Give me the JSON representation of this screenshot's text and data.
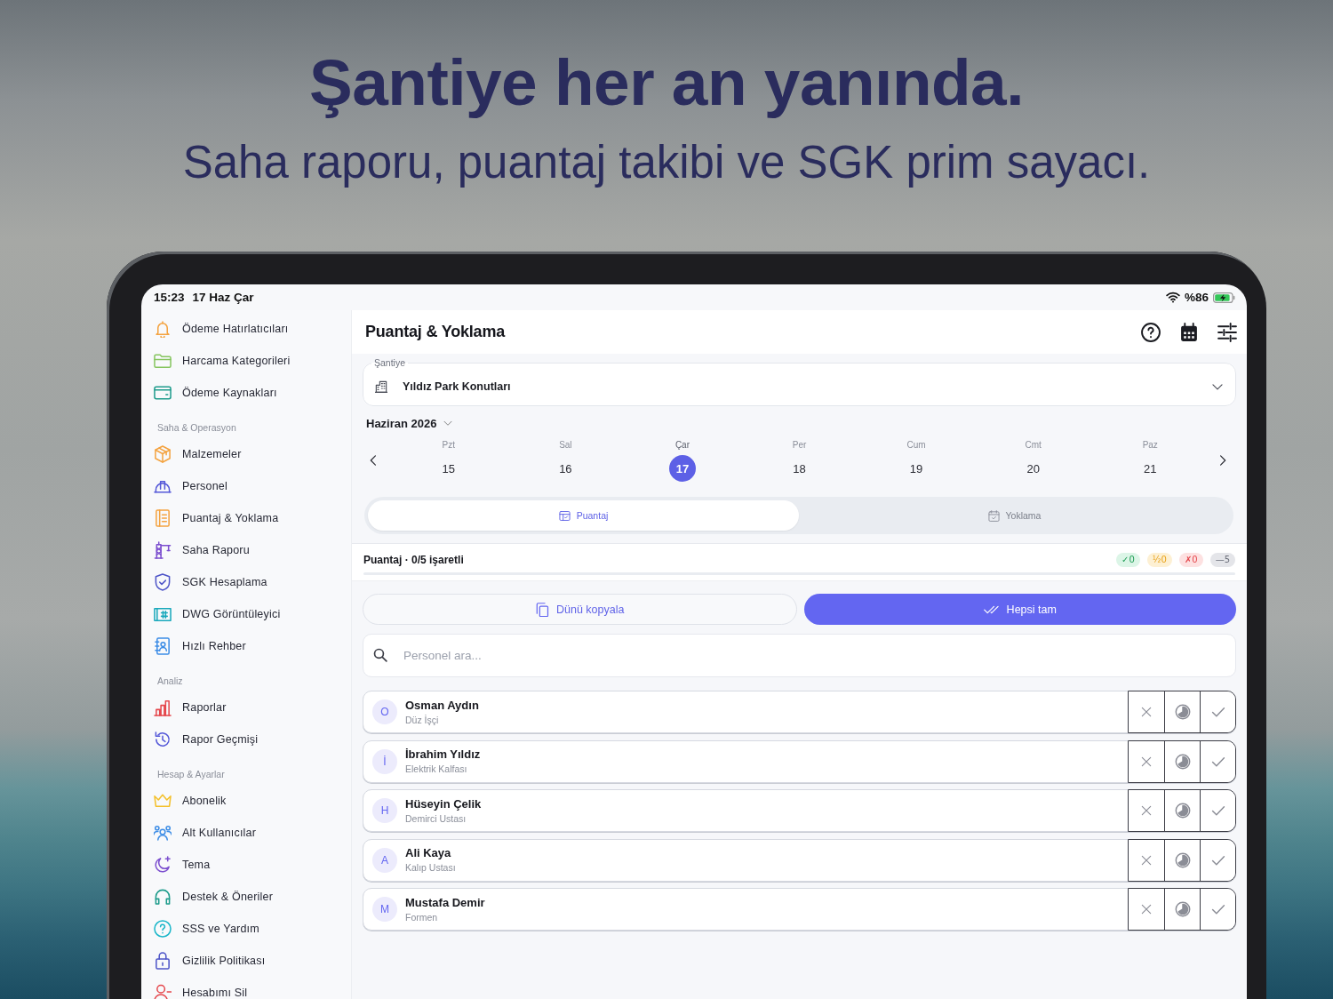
{
  "headline": {
    "title": "Şantiye her an yanında.",
    "subtitle": "Saha raporu, puantaj takibi ve SGK prim sayacı."
  },
  "status_bar": {
    "time": "15:23",
    "date": "17 Haz Çar",
    "battery": "%86",
    "charging": true
  },
  "sidebar": {
    "sections": [
      {
        "items": [
          "Ödeme Hatırlatıcıları",
          "Harcama Kategorileri",
          "Ödeme Kaynakları"
        ]
      },
      {
        "title": "Saha & Operasyon",
        "items": [
          "Malzemeler",
          "Personel",
          "Puantaj & Yoklama",
          "Saha Raporu",
          "SGK Hesaplama",
          "DWG Görüntüleyici",
          "Hızlı Rehber"
        ]
      },
      {
        "title": "Analiz",
        "items": [
          "Raporlar",
          "Rapor Geçmişi"
        ]
      },
      {
        "title": "Hesap & Ayarlar",
        "items": [
          "Abonelik",
          "Alt Kullanıcılar",
          "Tema",
          "Destek & Öneriler",
          "SSS ve Yardım",
          "Gizlilik Politikası",
          "Hesabımı Sil"
        ]
      }
    ]
  },
  "main": {
    "title": "Puantaj & Yoklama",
    "site_field": {
      "label": "Şantiye",
      "value": "Yıldız Park Konutları"
    },
    "month": "Haziran 2026",
    "days": [
      {
        "weekday": "Pzt",
        "day": "15",
        "selected": false
      },
      {
        "weekday": "Sal",
        "day": "16",
        "selected": false
      },
      {
        "weekday": "Çar",
        "day": "17",
        "selected": true
      },
      {
        "weekday": "Per",
        "day": "18",
        "selected": false
      },
      {
        "weekday": "Cum",
        "day": "19",
        "selected": false
      },
      {
        "weekday": "Cmt",
        "day": "20",
        "selected": false
      },
      {
        "weekday": "Paz",
        "day": "21",
        "selected": false
      }
    ],
    "view_tabs": [
      {
        "label": "Puantaj",
        "selected": true
      },
      {
        "label": "Yoklama",
        "selected": false
      }
    ],
    "summary": {
      "title": "Puantaj · 0/5 işaretli",
      "level": 0,
      "counts": [
        {
          "kind": "full",
          "text": "✓0"
        },
        {
          "kind": "half",
          "text": "½0"
        },
        {
          "kind": "absent",
          "text": "✗0"
        },
        {
          "kind": "unmarked",
          "text": "—5"
        }
      ]
    },
    "actions": [
      {
        "kind": "outline",
        "label": "Dünü kopyala"
      },
      {
        "kind": "filled",
        "label": "Hepsi tam"
      }
    ],
    "search": {
      "placeholder": "Personel ara..."
    },
    "workers": [
      {
        "initial": "O",
        "name": "Osman Aydın",
        "role": "Düz İşçi",
        "status_options": [
          {
            "kind": "absent",
            "selected": false
          },
          {
            "kind": "half",
            "selected": false
          },
          {
            "kind": "full",
            "selected": false
          }
        ]
      },
      {
        "initial": "İ",
        "name": "İbrahim Yıldız",
        "role": "Elektrik Kalfası",
        "status_options": [
          {
            "kind": "absent",
            "selected": false
          },
          {
            "kind": "half",
            "selected": false
          },
          {
            "kind": "full",
            "selected": false
          }
        ]
      },
      {
        "initial": "H",
        "name": "Hüseyin Çelik",
        "role": "Demirci Ustası",
        "status_options": [
          {
            "kind": "absent",
            "selected": false
          },
          {
            "kind": "half",
            "selected": false
          },
          {
            "kind": "full",
            "selected": false
          }
        ]
      },
      {
        "initial": "A",
        "name": "Ali Kaya",
        "role": "Kalıp Ustası",
        "status_options": [
          {
            "kind": "absent",
            "selected": false
          },
          {
            "kind": "half",
            "selected": false
          },
          {
            "kind": "full",
            "selected": false
          }
        ]
      },
      {
        "initial": "M",
        "name": "Mustafa Demir",
        "role": "Formen",
        "status_options": [
          {
            "kind": "absent",
            "selected": false
          },
          {
            "kind": "half",
            "selected": false
          },
          {
            "kind": "full",
            "selected": false
          }
        ]
      }
    ]
  }
}
